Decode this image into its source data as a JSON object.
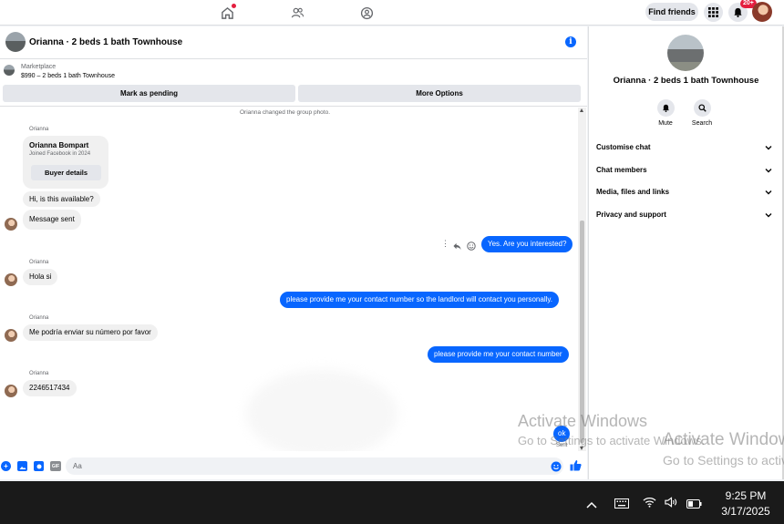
{
  "topnav": {
    "find_friends_label": "Find friends",
    "notification_count": "20+"
  },
  "chat_header": {
    "title": "Orianna · 2 beds 1 bath Townhouse"
  },
  "listing": {
    "label": "Marketplace",
    "price_title": "$990 – 2 beds 1 bath Townhouse",
    "mark_pending_label": "Mark as pending",
    "more_options_label": "More Options"
  },
  "messages": {
    "system_note": "Orianna changed the group photo.",
    "sender_name": "Orianna",
    "card": {
      "name": "Orianna Bompart",
      "joined": "Joined Facebook in 2024",
      "button": "Buyer details"
    },
    "m1": "Hi, is this available?",
    "m2": "Message sent",
    "m3": "Yes. Are you interested?",
    "m4": "Hola si",
    "m5": "please provide me your contact number  so the landlord will contact you personally.",
    "m6": "Me podría enviar su número por favor",
    "m7": "please provide me your contact number",
    "m8": "2246517434",
    "m9": "ok",
    "sent_status": "Sent"
  },
  "composer": {
    "placeholder": "Aa"
  },
  "right_panel": {
    "title": "Orianna · 2 beds 1 bath Townhouse",
    "mute_label": "Mute",
    "search_label": "Search",
    "sections": [
      "Customise chat",
      "Chat members",
      "Media, files and links",
      "Privacy and support"
    ]
  },
  "watermark": {
    "title": "Activate Windows",
    "subtitle": "Go to Settings to activate Windows."
  },
  "taskbar": {
    "time": "9:25 PM",
    "date": "3/17/2025"
  },
  "colors": {
    "accent": "#0866ff",
    "bubble_in": "#f0f0f0",
    "badge": "#e41e3f"
  }
}
